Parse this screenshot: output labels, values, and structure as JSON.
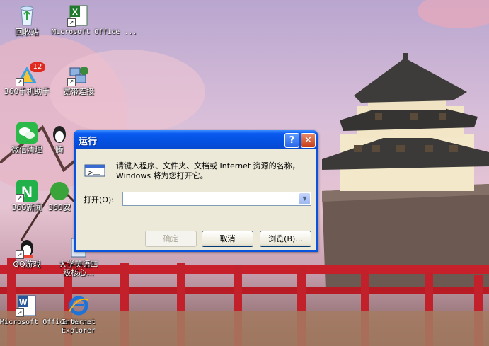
{
  "desktop": {
    "icons": [
      {
        "label": "回收站",
        "icon": "recycle-bin-icon"
      },
      {
        "label": "Microsoft Office ...",
        "icon": "excel-icon"
      },
      {
        "label": "360手机助手",
        "icon": "phone-assistant-icon",
        "badge": "12"
      },
      {
        "label": "宽带连接",
        "icon": "broadband-icon"
      },
      {
        "label": "微信清理",
        "icon": "wechat-clean-icon"
      },
      {
        "label": "腾",
        "icon": "qq-penguin-icon"
      },
      {
        "label": "360新闻",
        "icon": "news-icon"
      },
      {
        "label": "360安",
        "icon": "security-icon"
      },
      {
        "label": "QQ游戏",
        "icon": "qq-game-icon"
      },
      {
        "label": "大学英语四级核心...",
        "icon": "book-icon"
      },
      {
        "label": "Microsoft Office W...",
        "icon": "word-icon"
      },
      {
        "label": "Internet Explorer",
        "icon": "ie-icon"
      }
    ]
  },
  "run_dialog": {
    "title": "运行",
    "help_glyph": "?",
    "close_glyph": "✕",
    "description": "请键入程序、文件夹、文档或 Internet 资源的名称，Windows 将为您打开它。",
    "open_label": "打开(O):",
    "input_value": "",
    "ok_label": "确定",
    "cancel_label": "取消",
    "browse_label": "浏览(B)..."
  },
  "colors": {
    "title_bar": "#0450e0",
    "dialog_face": "#ece9d8",
    "close_button": "#c63d18"
  }
}
